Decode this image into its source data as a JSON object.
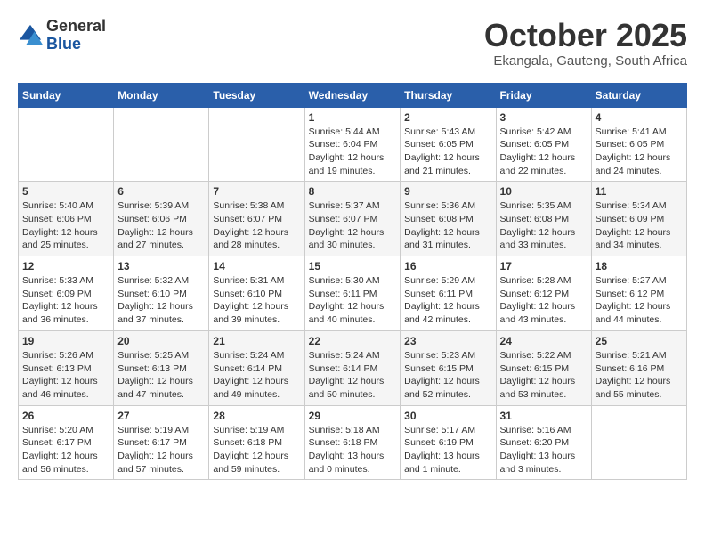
{
  "header": {
    "logo_general": "General",
    "logo_blue": "Blue",
    "month_title": "October 2025",
    "location": "Ekangala, Gauteng, South Africa"
  },
  "weekdays": [
    "Sunday",
    "Monday",
    "Tuesday",
    "Wednesday",
    "Thursday",
    "Friday",
    "Saturday"
  ],
  "weeks": [
    [
      {
        "day": "",
        "text": ""
      },
      {
        "day": "",
        "text": ""
      },
      {
        "day": "",
        "text": ""
      },
      {
        "day": "1",
        "text": "Sunrise: 5:44 AM\nSunset: 6:04 PM\nDaylight: 12 hours\nand 19 minutes."
      },
      {
        "day": "2",
        "text": "Sunrise: 5:43 AM\nSunset: 6:05 PM\nDaylight: 12 hours\nand 21 minutes."
      },
      {
        "day": "3",
        "text": "Sunrise: 5:42 AM\nSunset: 6:05 PM\nDaylight: 12 hours\nand 22 minutes."
      },
      {
        "day": "4",
        "text": "Sunrise: 5:41 AM\nSunset: 6:05 PM\nDaylight: 12 hours\nand 24 minutes."
      }
    ],
    [
      {
        "day": "5",
        "text": "Sunrise: 5:40 AM\nSunset: 6:06 PM\nDaylight: 12 hours\nand 25 minutes."
      },
      {
        "day": "6",
        "text": "Sunrise: 5:39 AM\nSunset: 6:06 PM\nDaylight: 12 hours\nand 27 minutes."
      },
      {
        "day": "7",
        "text": "Sunrise: 5:38 AM\nSunset: 6:07 PM\nDaylight: 12 hours\nand 28 minutes."
      },
      {
        "day": "8",
        "text": "Sunrise: 5:37 AM\nSunset: 6:07 PM\nDaylight: 12 hours\nand 30 minutes."
      },
      {
        "day": "9",
        "text": "Sunrise: 5:36 AM\nSunset: 6:08 PM\nDaylight: 12 hours\nand 31 minutes."
      },
      {
        "day": "10",
        "text": "Sunrise: 5:35 AM\nSunset: 6:08 PM\nDaylight: 12 hours\nand 33 minutes."
      },
      {
        "day": "11",
        "text": "Sunrise: 5:34 AM\nSunset: 6:09 PM\nDaylight: 12 hours\nand 34 minutes."
      }
    ],
    [
      {
        "day": "12",
        "text": "Sunrise: 5:33 AM\nSunset: 6:09 PM\nDaylight: 12 hours\nand 36 minutes."
      },
      {
        "day": "13",
        "text": "Sunrise: 5:32 AM\nSunset: 6:10 PM\nDaylight: 12 hours\nand 37 minutes."
      },
      {
        "day": "14",
        "text": "Sunrise: 5:31 AM\nSunset: 6:10 PM\nDaylight: 12 hours\nand 39 minutes."
      },
      {
        "day": "15",
        "text": "Sunrise: 5:30 AM\nSunset: 6:11 PM\nDaylight: 12 hours\nand 40 minutes."
      },
      {
        "day": "16",
        "text": "Sunrise: 5:29 AM\nSunset: 6:11 PM\nDaylight: 12 hours\nand 42 minutes."
      },
      {
        "day": "17",
        "text": "Sunrise: 5:28 AM\nSunset: 6:12 PM\nDaylight: 12 hours\nand 43 minutes."
      },
      {
        "day": "18",
        "text": "Sunrise: 5:27 AM\nSunset: 6:12 PM\nDaylight: 12 hours\nand 44 minutes."
      }
    ],
    [
      {
        "day": "19",
        "text": "Sunrise: 5:26 AM\nSunset: 6:13 PM\nDaylight: 12 hours\nand 46 minutes."
      },
      {
        "day": "20",
        "text": "Sunrise: 5:25 AM\nSunset: 6:13 PM\nDaylight: 12 hours\nand 47 minutes."
      },
      {
        "day": "21",
        "text": "Sunrise: 5:24 AM\nSunset: 6:14 PM\nDaylight: 12 hours\nand 49 minutes."
      },
      {
        "day": "22",
        "text": "Sunrise: 5:24 AM\nSunset: 6:14 PM\nDaylight: 12 hours\nand 50 minutes."
      },
      {
        "day": "23",
        "text": "Sunrise: 5:23 AM\nSunset: 6:15 PM\nDaylight: 12 hours\nand 52 minutes."
      },
      {
        "day": "24",
        "text": "Sunrise: 5:22 AM\nSunset: 6:15 PM\nDaylight: 12 hours\nand 53 minutes."
      },
      {
        "day": "25",
        "text": "Sunrise: 5:21 AM\nSunset: 6:16 PM\nDaylight: 12 hours\nand 55 minutes."
      }
    ],
    [
      {
        "day": "26",
        "text": "Sunrise: 5:20 AM\nSunset: 6:17 PM\nDaylight: 12 hours\nand 56 minutes."
      },
      {
        "day": "27",
        "text": "Sunrise: 5:19 AM\nSunset: 6:17 PM\nDaylight: 12 hours\nand 57 minutes."
      },
      {
        "day": "28",
        "text": "Sunrise: 5:19 AM\nSunset: 6:18 PM\nDaylight: 12 hours\nand 59 minutes."
      },
      {
        "day": "29",
        "text": "Sunrise: 5:18 AM\nSunset: 6:18 PM\nDaylight: 13 hours\nand 0 minutes."
      },
      {
        "day": "30",
        "text": "Sunrise: 5:17 AM\nSunset: 6:19 PM\nDaylight: 13 hours\nand 1 minute."
      },
      {
        "day": "31",
        "text": "Sunrise: 5:16 AM\nSunset: 6:20 PM\nDaylight: 13 hours\nand 3 minutes."
      },
      {
        "day": "",
        "text": ""
      }
    ]
  ]
}
